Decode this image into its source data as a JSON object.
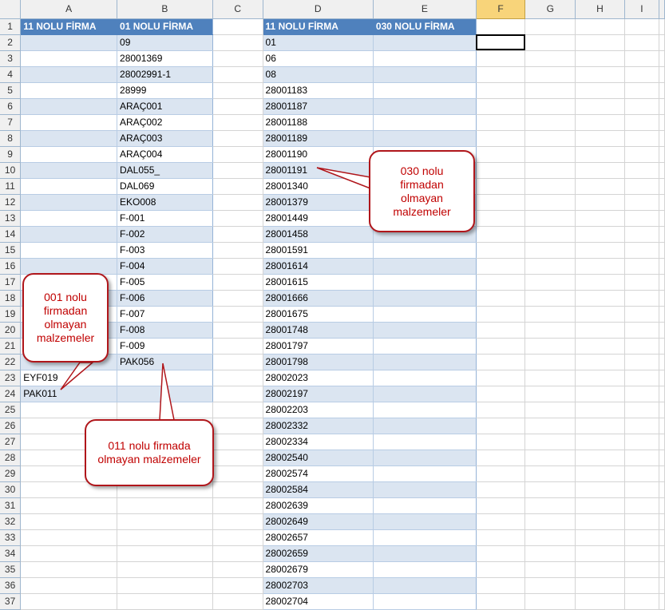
{
  "columns": [
    "A",
    "B",
    "C",
    "D",
    "E",
    "F",
    "G",
    "H",
    "I"
  ],
  "selected_column": "F",
  "selected_cell": "F2",
  "table1_headers": [
    "11 NOLU FİRMA",
    "01 NOLU FİRMA"
  ],
  "table2_headers": [
    "11 NOLU FİRMA",
    "030 NOLU FİRMA"
  ],
  "rows": [
    {
      "n": "1",
      "a": "",
      "b": "",
      "d": "",
      "e": ""
    },
    {
      "n": "2",
      "a": "",
      "b": "09",
      "d": "01",
      "e": ""
    },
    {
      "n": "3",
      "a": "",
      "b": "28001369",
      "d": "06",
      "e": ""
    },
    {
      "n": "4",
      "a": "",
      "b": "28002991-1",
      "d": "08",
      "e": ""
    },
    {
      "n": "5",
      "a": "",
      "b": "28999",
      "d": "28001183",
      "e": ""
    },
    {
      "n": "6",
      "a": "",
      "b": "ARAÇ001",
      "d": "28001187",
      "e": ""
    },
    {
      "n": "7",
      "a": "",
      "b": "ARAÇ002",
      "d": "28001188",
      "e": ""
    },
    {
      "n": "8",
      "a": "",
      "b": "ARAÇ003",
      "d": "28001189",
      "e": ""
    },
    {
      "n": "9",
      "a": "",
      "b": "ARAÇ004",
      "d": "28001190",
      "e": ""
    },
    {
      "n": "10",
      "a": "",
      "b": "DAL055_",
      "d": "28001191",
      "e": ""
    },
    {
      "n": "11",
      "a": "",
      "b": "DAL069",
      "d": "28001340",
      "e": ""
    },
    {
      "n": "12",
      "a": "",
      "b": "EKO008",
      "d": "28001379",
      "e": ""
    },
    {
      "n": "13",
      "a": "",
      "b": "F-001",
      "d": "28001449",
      "e": ""
    },
    {
      "n": "14",
      "a": "",
      "b": "F-002",
      "d": "28001458",
      "e": ""
    },
    {
      "n": "15",
      "a": "",
      "b": "F-003",
      "d": "28001591",
      "e": ""
    },
    {
      "n": "16",
      "a": "",
      "b": "F-004",
      "d": "28001614",
      "e": ""
    },
    {
      "n": "17",
      "a": "",
      "b": "F-005",
      "d": "28001615",
      "e": ""
    },
    {
      "n": "18",
      "a": "",
      "b": "F-006",
      "d": "28001666",
      "e": ""
    },
    {
      "n": "19",
      "a": "",
      "b": "F-007",
      "d": "28001675",
      "e": ""
    },
    {
      "n": "20",
      "a": "",
      "b": "F-008",
      "d": "28001748",
      "e": ""
    },
    {
      "n": "21",
      "a": "",
      "b": "F-009",
      "d": "28001797",
      "e": ""
    },
    {
      "n": "22",
      "a": "",
      "b": "PAK056",
      "d": "28001798",
      "e": ""
    },
    {
      "n": "23",
      "a": "EYF019",
      "b": "",
      "d": "28002023",
      "e": ""
    },
    {
      "n": "24",
      "a": "PAK011",
      "b": "",
      "d": "28002197",
      "e": ""
    },
    {
      "n": "25",
      "a": "",
      "b": "",
      "d": "28002203",
      "e": ""
    },
    {
      "n": "26",
      "a": "",
      "b": "",
      "d": "28002332",
      "e": ""
    },
    {
      "n": "27",
      "a": "",
      "b": "",
      "d": "28002334",
      "e": ""
    },
    {
      "n": "28",
      "a": "",
      "b": "",
      "d": "28002540",
      "e": ""
    },
    {
      "n": "29",
      "a": "",
      "b": "",
      "d": "28002574",
      "e": ""
    },
    {
      "n": "30",
      "a": "",
      "b": "",
      "d": "28002584",
      "e": ""
    },
    {
      "n": "31",
      "a": "",
      "b": "",
      "d": "28002639",
      "e": ""
    },
    {
      "n": "32",
      "a": "",
      "b": "",
      "d": "28002649",
      "e": ""
    },
    {
      "n": "33",
      "a": "",
      "b": "",
      "d": "28002657",
      "e": ""
    },
    {
      "n": "34",
      "a": "",
      "b": "",
      "d": "28002659",
      "e": ""
    },
    {
      "n": "35",
      "a": "",
      "b": "",
      "d": "28002679",
      "e": ""
    },
    {
      "n": "36",
      "a": "",
      "b": "",
      "d": "28002703",
      "e": ""
    },
    {
      "n": "37",
      "a": "",
      "b": "",
      "d": "28002704",
      "e": ""
    }
  ],
  "callouts": {
    "c030": "030 nolu firmadan olmayan malzemeler",
    "c001": "001 nolu firmadan olmayan malzemeler",
    "c011": "011 nolu firmada olmayan malzemeler"
  }
}
